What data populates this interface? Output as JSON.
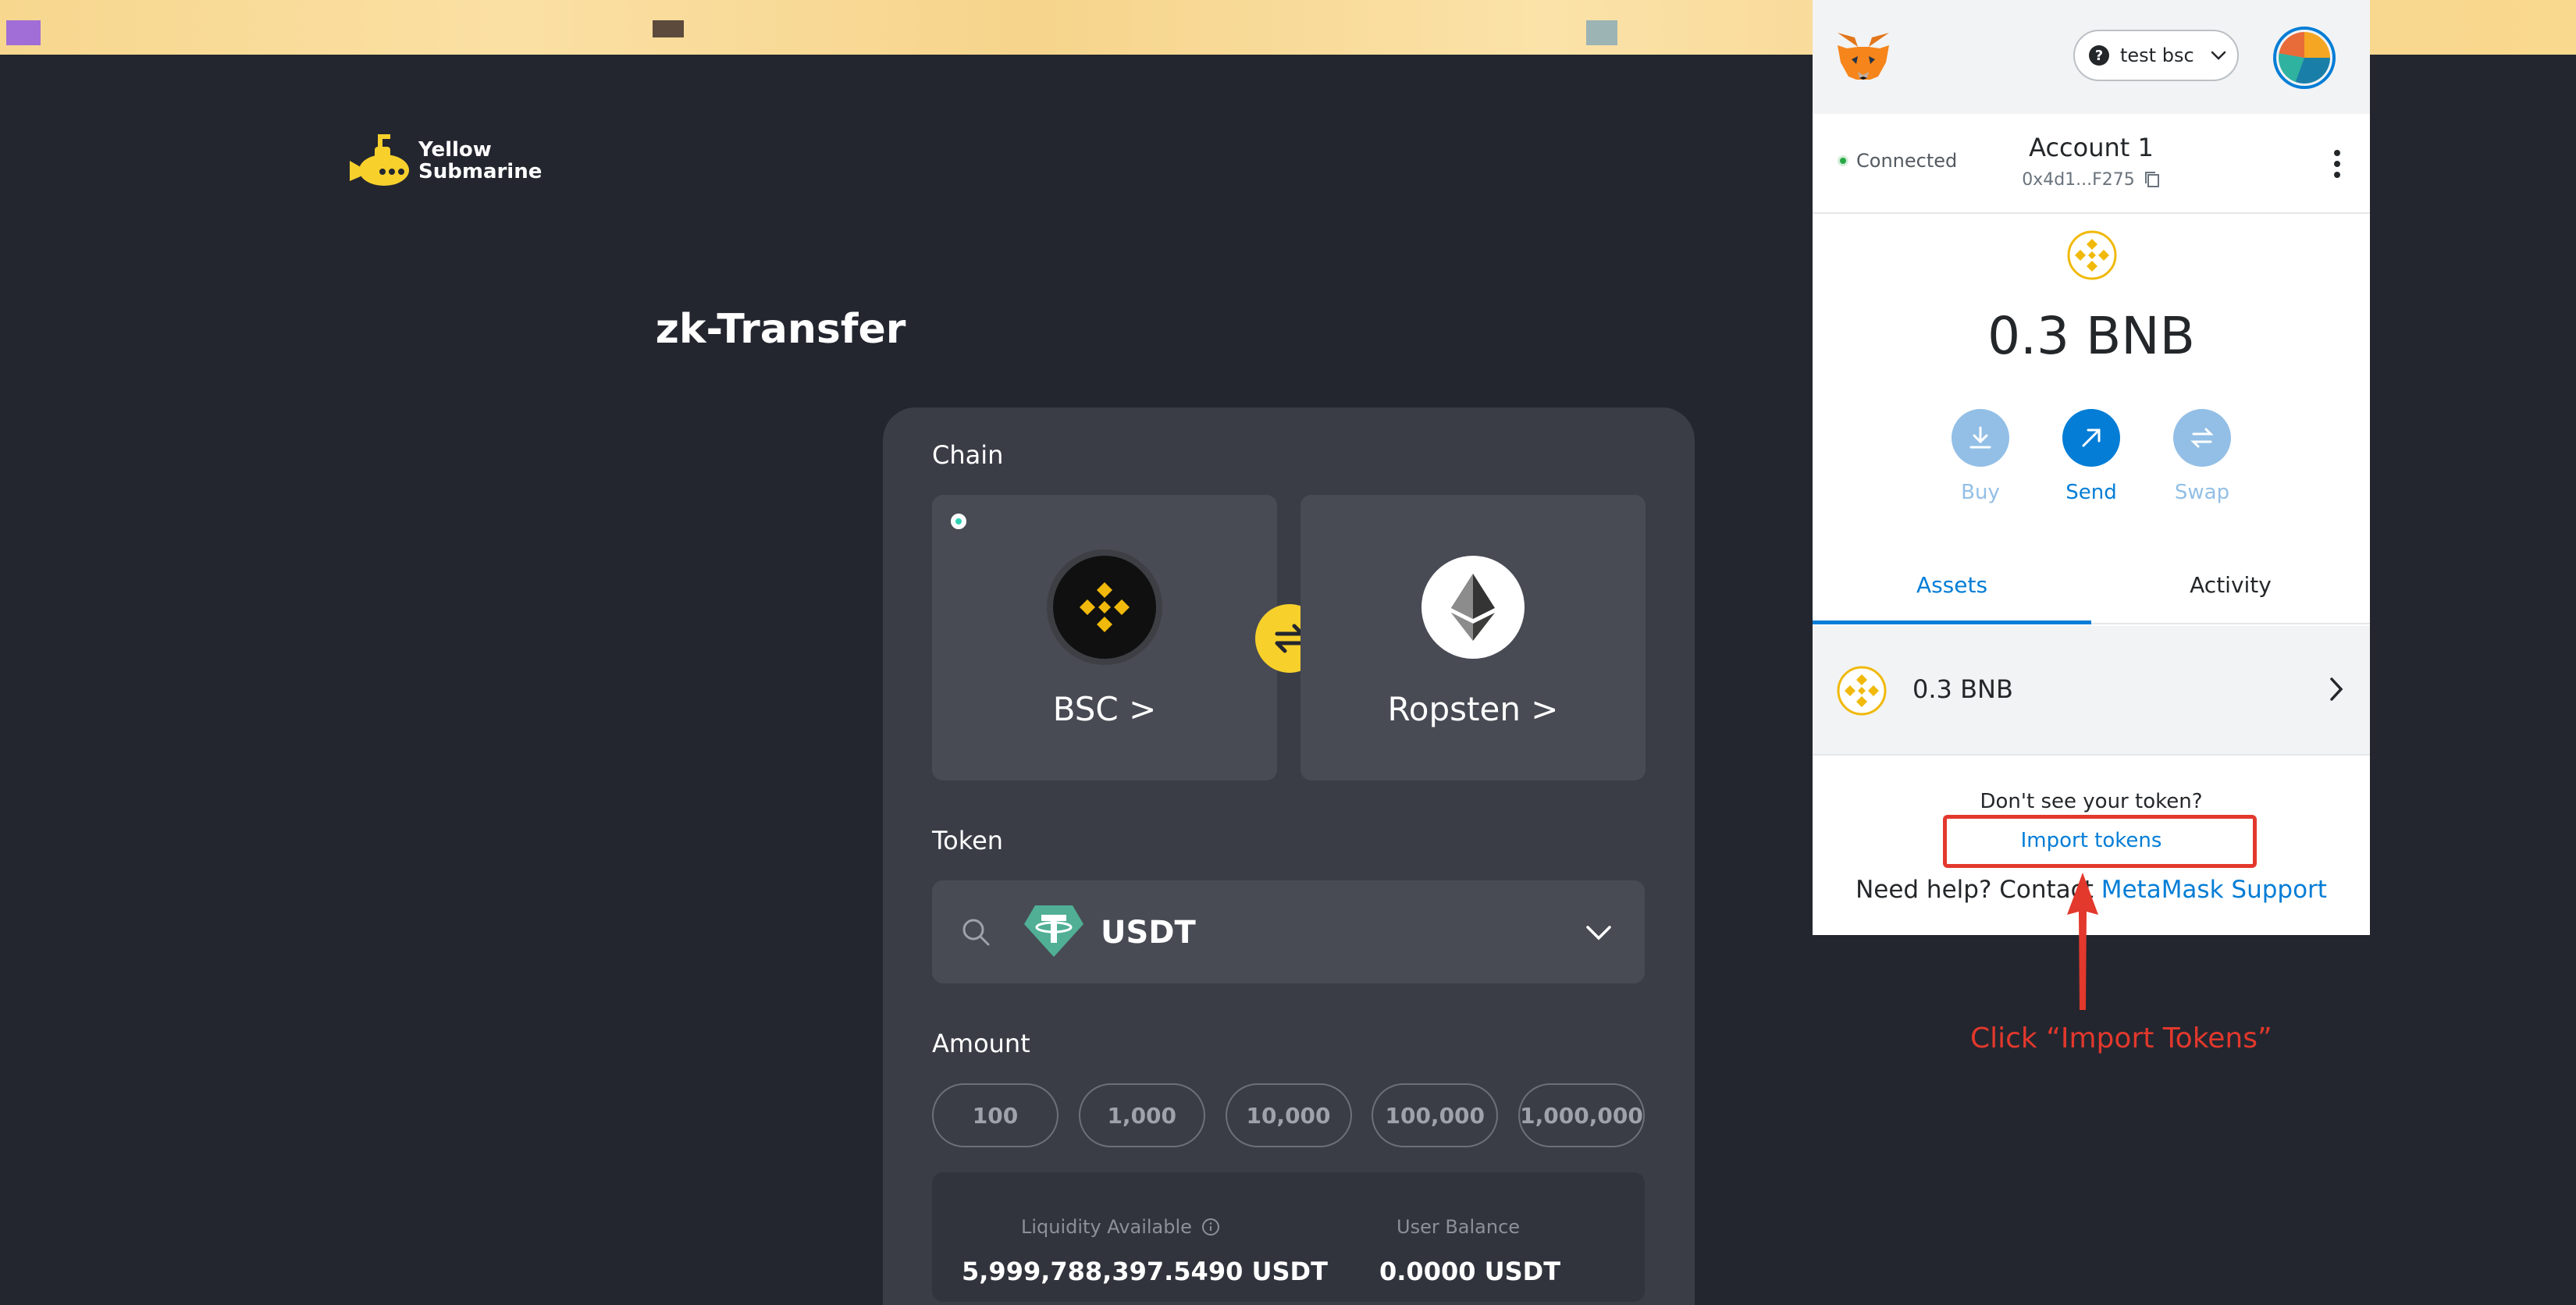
{
  "site": {
    "logo_line1": "Yellow",
    "logo_line2": "Submarine",
    "title": "zk-Transfer"
  },
  "chain": {
    "label": "Chain",
    "from": {
      "name": "BSC >",
      "selected": true
    },
    "to": {
      "name": "Ropsten >"
    }
  },
  "token": {
    "label": "Token",
    "selected": "USDT"
  },
  "amount": {
    "label": "Amount",
    "options": [
      "100",
      "1,000",
      "10,000",
      "100,000",
      "1,000,000"
    ]
  },
  "liquidity": {
    "available_label": "Liquidity Available",
    "available_value": "5,999,788,397.5490 USDT",
    "balance_label": "User Balance",
    "balance_value": "0.0000 USDT"
  },
  "metamask": {
    "network": "test bsc",
    "connected_label": "Connected",
    "account_name": "Account 1",
    "account_address": "0x4d1...F275",
    "balance": "0.3 BNB",
    "actions": {
      "buy": "Buy",
      "send": "Send",
      "swap": "Swap"
    },
    "tabs": {
      "assets": "Assets",
      "activity": "Activity"
    },
    "asset_row": "0.3 BNB",
    "dont_see": "Don't see your token?",
    "import_tokens": "Import tokens",
    "need_help": "Need help? Contact ",
    "support_link": "MetaMask Support"
  },
  "annotation": {
    "text": "Click “Import Tokens”",
    "color": "#e3382c"
  },
  "colors": {
    "page_bg": "#23262f",
    "card_bg": "#3a3d46",
    "accent_yellow": "#f7d02c",
    "metamask_blue": "#037dd6"
  }
}
